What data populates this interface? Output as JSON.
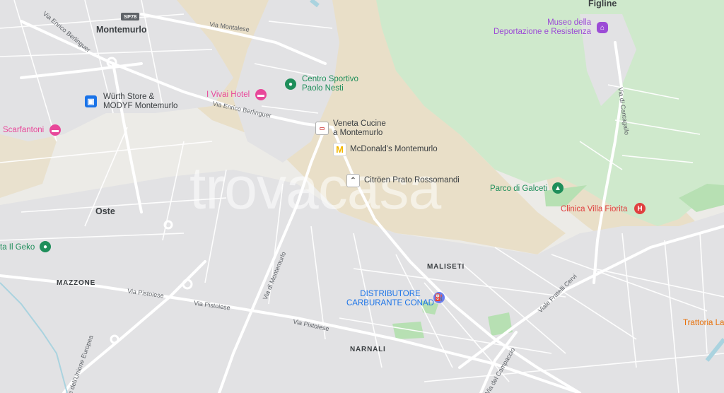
{
  "watermark": "trovacasa",
  "colors": {
    "land": "#ecebe7",
    "urban": "#e2e2e4",
    "hills": "#e9dfc8",
    "forest": "#cfe9cc",
    "road": "#ffffff",
    "poi_green": "#1e8e5a",
    "poi_pink": "#e8489a",
    "poi_blue": "#1a73e8",
    "poi_purple": "#9c4bd6",
    "poi_red": "#e04040",
    "poi_orange": "#e8710a"
  },
  "places": {
    "figline": "Figline",
    "montemurlo": "Montemurlo",
    "oste": "Oste",
    "mazzone": "MAZZONE",
    "maliseti": "MALISETI",
    "narnali": "NARNALI"
  },
  "roads": {
    "sp78": "SP78",
    "via_montalese": "Via Montalese",
    "via_enrico_berlinguer_1": "Via Enrico Berlinguer",
    "via_enrico_berlinguer_2": "Via Enrico Berlinguer",
    "via_di_montemurlo": "Via di Montemurlo",
    "via_pistoiese_1": "Via Pistoiese",
    "via_pistoiese_2": "Via Pistoiese",
    "via_pistoiese_3": "Via Pistoiese",
    "via_unione_europea": "Viale dell'Unione Europea",
    "via_cantagallo": "Via di Cantagallo",
    "viale_fratelli_cervi": "Viale Fratelli Cervi",
    "via_campaccio": "Via del Campaccio"
  },
  "pois": {
    "museo": "Museo della\nDeportazione e Resistenza",
    "centro_sportivo": "Centro Sportivo\nPaolo Nesti",
    "vivai_hotel": "I Vivai Hotel",
    "wurth": "Würth Store &\nMODYF Montemurlo",
    "scarfantoni": "Scarfantoni",
    "veneta_cucine": "Veneta Cucine\na Montemurlo",
    "mcdonalds": "McDonald's Montemurlo",
    "citroen": "Citröen Prato Rossomandi",
    "parco_galceti": "Parco di Galceti",
    "clinica": "Clinica Villa Fiorita",
    "geko": "ta Il Geko",
    "conad": "DISTRIBUTORE\nCARBURANTE CONAD",
    "trattoria": "Trattoria La"
  },
  "icons": {
    "museo": "museum-icon",
    "centro_sportivo": "park-icon",
    "vivai_hotel": "hotel-icon",
    "wurth": "shopping-bag-icon",
    "scarfantoni": "bed-icon",
    "veneta_cucine": "store-logo-icon",
    "mcdonalds": "mcdonalds-logo-icon",
    "citroen": "citroen-logo-icon",
    "parco_galceti": "tree-icon",
    "clinica": "hospital-icon",
    "geko": "park-icon",
    "conad": "fuel-icon"
  }
}
